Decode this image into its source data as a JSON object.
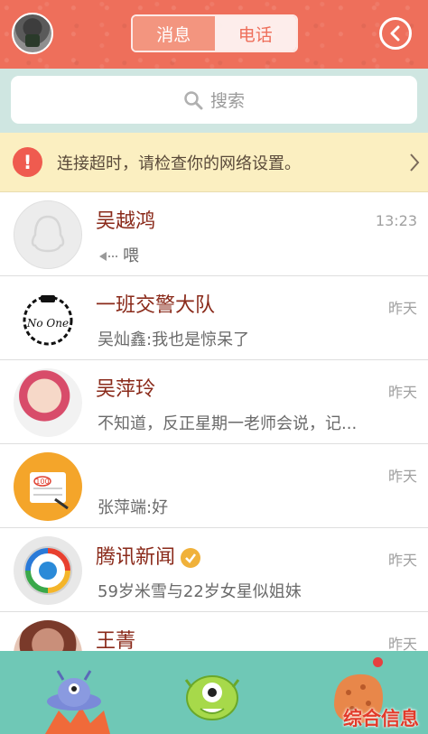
{
  "header": {
    "tabs": [
      {
        "label": "消息",
        "active": true
      },
      {
        "label": "电话",
        "active": false
      }
    ],
    "avatar_icon": "user-avatar",
    "back_icon": "chevron-left-circle-icon",
    "accent_color": "#ee6f5b"
  },
  "search": {
    "placeholder": "搜索",
    "icon": "search-icon"
  },
  "notice": {
    "text": "连接超时，请检查你的网络设置。",
    "icon": "alert-icon",
    "arrow_icon": "chevron-right-icon"
  },
  "conversations": [
    {
      "name": "吴越鸿",
      "time": "13:23",
      "message": "喂",
      "message_icon": "voice-call-icon"
    },
    {
      "name": "一班交警大队",
      "time": "昨天",
      "message": "吴灿鑫:我也是惊呆了"
    },
    {
      "name": "吴萍玲",
      "time": "昨天",
      "message": "不知道，反正星期一老师会说，记..."
    },
    {
      "name": "",
      "time": "昨天",
      "message": "张萍端:好"
    },
    {
      "name": "腾讯新闻",
      "time": "昨天",
      "message": "59岁米雪与22岁女星似姐妹",
      "verified": true
    },
    {
      "name": "王菁",
      "time": "昨天",
      "message": ""
    }
  ],
  "avatar_badges": {
    "police": "No One",
    "note": "100"
  },
  "bottom_tabs": [
    {
      "name": "messages-tab",
      "icon": "ufo-monster-icon"
    },
    {
      "name": "contacts-tab",
      "icon": "green-monster-icon"
    },
    {
      "name": "dynamic-tab",
      "icon": "orange-monster-icon",
      "badge": true
    }
  ],
  "watermark": "综合信息"
}
